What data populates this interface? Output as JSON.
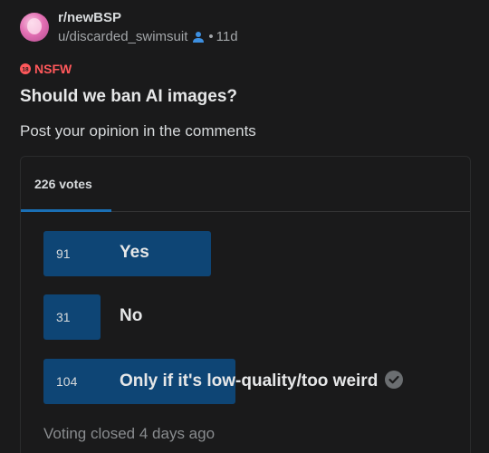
{
  "post": {
    "subreddit": "r/newBSP",
    "username": "u/discarded_swimsuit",
    "age": "11d",
    "nsfw_label": "NSFW",
    "title": "Should we ban AI images?",
    "body": "Post your opinion in the comments"
  },
  "poll": {
    "total_votes_label": "226 votes",
    "options": [
      {
        "count": "91",
        "label": "Yes",
        "share": 0.4027
      },
      {
        "count": "31",
        "label": "No",
        "share": 0.1372
      },
      {
        "count": "104",
        "label": "Only if it's low-quality/too weird",
        "share": 0.4602,
        "winner": true
      }
    ],
    "closed_text": "Voting closed 4 days ago"
  },
  "colors": {
    "accent_blue": "#1a6fb5",
    "bar_fill": "#0e4575",
    "nsfw_red": "#ff585b",
    "background": "#1a1a1b"
  },
  "icons": {
    "user": "user-icon",
    "nsfw": "nsfw-icon",
    "winner": "check-circle-icon"
  }
}
